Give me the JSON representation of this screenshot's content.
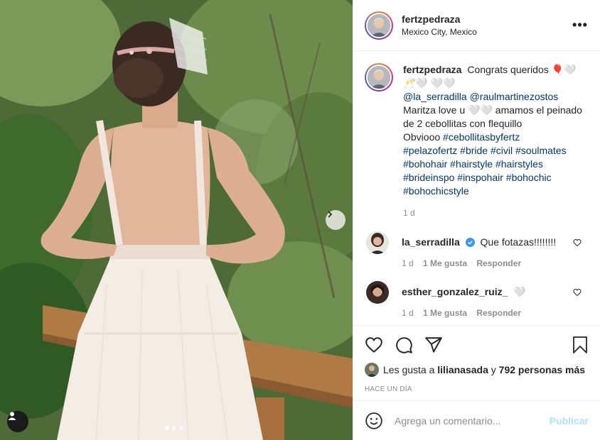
{
  "post": {
    "username": "fertzpedraza",
    "location": "Mexico City, Mexico",
    "more_label": "•••",
    "carousel": {
      "slides": 3,
      "active": 1
    }
  },
  "caption": {
    "username": "fertzpedraza",
    "line1": "Congrats queridos 🎈🤍",
    "line2": "🥂🤍 🤍🤍",
    "mention1": "@la_serradilla",
    "mention2": "@raulmartinezostos",
    "line3": "Maritza love u 🤍🤍 amamos el peinado de 2 cebollitas con flequillo",
    "line4": "Obviooo",
    "tags": [
      "#cebollitasbyfertz",
      "#pelazofertz",
      "#bride",
      "#civil",
      "#soulmates",
      "#bohohair",
      "#hairstyle",
      "#hairstyles",
      "#brideinspo",
      "#inspohair",
      "#bohochic",
      "#bohochicstyle"
    ],
    "time": "1 d"
  },
  "comments": [
    {
      "username": "la_serradilla",
      "verified": true,
      "text": "Que fotazas!!!!!!!!",
      "time": "1 d",
      "likes": "1 Me gusta",
      "reply": "Responder"
    },
    {
      "username": "esther_gonzalez_ruiz_",
      "verified": false,
      "text": "🤍",
      "time": "1 d",
      "likes": "1 Me gusta",
      "reply": "Responder"
    }
  ],
  "likes": {
    "prefix": "Les gusta a",
    "user": "lilianasada",
    "middle": "y",
    "count": "792 personas más"
  },
  "time_ago": "HACE UN DÍA",
  "add_comment": {
    "placeholder": "Agrega un comentario...",
    "publish": "Publicar"
  },
  "icons": [
    "chevron-right-icon",
    "user-tag-icon",
    "heart-icon",
    "comment-icon",
    "share-icon",
    "bookmark-icon",
    "emoji-icon",
    "verified-badge-icon",
    "more-options-icon"
  ]
}
